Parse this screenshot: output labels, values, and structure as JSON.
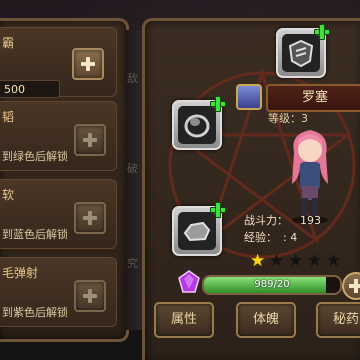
{
  "skills": [
    {
      "name": "霸",
      "value": "500",
      "note": ""
    },
    {
      "name": "韬",
      "note": "到绿色后解锁"
    },
    {
      "name": "软",
      "note": "到蓝色后解锁"
    },
    {
      "name": "毛弹射",
      "note": "到紫色后解锁"
    }
  ],
  "side_glyphs": [
    "敌",
    "破",
    "究"
  ],
  "hero": {
    "name": "罗塞",
    "level_label": "等级：3",
    "combat_label": "战斗力：",
    "combat_value": "193",
    "exp_label": "经验：",
    "exp_value": ": 4",
    "stars_total": 5,
    "stars_filled": 1
  },
  "exp_bar": {
    "text": "989/20",
    "fill_fraction": 0.9
  },
  "tabs": [
    {
      "label": "属性"
    },
    {
      "label": "体魄"
    },
    {
      "label": "秘药"
    }
  ],
  "colors": {
    "accent_green": "#3fe23a",
    "panel_border": "#6d5338",
    "star_on": "#ffd21e"
  },
  "icons": {
    "add": "green-plus-icon",
    "equip_1": "armor-icon",
    "equip_2": "ring-icon",
    "equip_3": "stone-icon",
    "gem": "purple-gem-icon"
  }
}
